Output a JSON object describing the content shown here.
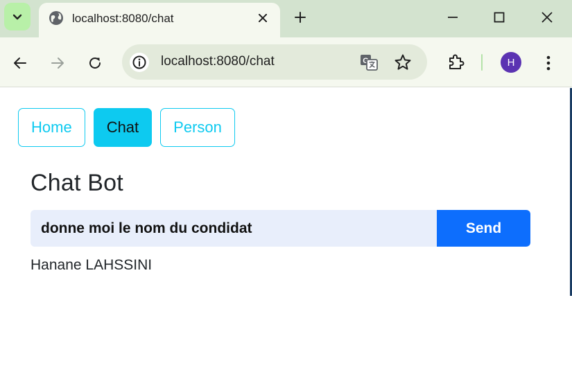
{
  "browser": {
    "tab": {
      "title": "localhost:8080/chat"
    },
    "omnibox": {
      "url": "localhost:8080/chat"
    },
    "profile": {
      "initial": "H",
      "color": "#5b33b2"
    }
  },
  "app": {
    "nav": [
      {
        "label": "Home",
        "active": false
      },
      {
        "label": "Chat",
        "active": true
      },
      {
        "label": "Person",
        "active": false
      }
    ],
    "title": "Chat Bot",
    "chat": {
      "input_value": "donne moi le nom du condidat",
      "send_label": "Send",
      "answer": "Hanane LAHSSINI"
    },
    "colors": {
      "info": "#0dcaf0",
      "primary": "#0d6efd",
      "input_bg": "#e8eefb"
    }
  },
  "icons": [
    "tab-search-icon",
    "globe-icon",
    "close-icon",
    "plus-icon",
    "minimize-icon",
    "maximize-icon",
    "close-window-icon",
    "back-icon",
    "forward-icon",
    "reload-icon",
    "site-info-icon",
    "translate-icon",
    "star-icon",
    "extensions-icon",
    "menu-icon"
  ]
}
